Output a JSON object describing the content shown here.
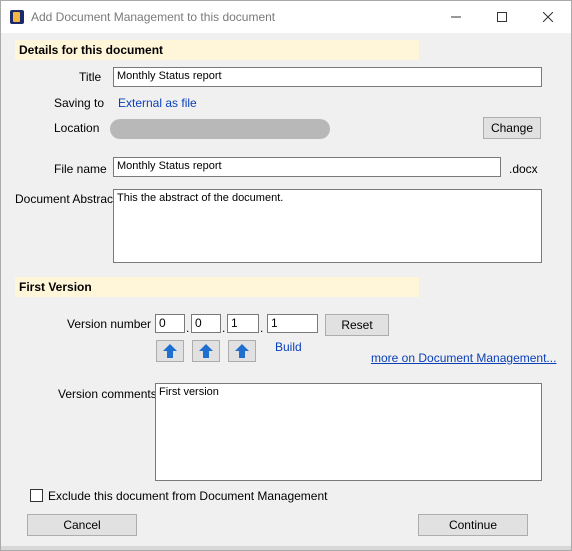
{
  "window": {
    "title": "Add Document Management to this document",
    "minimize_glyph": "—",
    "maximize_glyph": "☐",
    "close_glyph": "✕"
  },
  "details": {
    "header": "Details for this document",
    "title_label": "Title",
    "title_value": "Monthly Status report",
    "saving_to_label": "Saving to",
    "saving_to_value": "External as file",
    "location_label": "Location",
    "change_button": "Change",
    "filename_label": "File name",
    "filename_value": "Monthly Status report",
    "extension": ".docx",
    "abstract_label": "Document Abstract",
    "abstract_value": "This the abstract of the document."
  },
  "version": {
    "header": "First Version",
    "number_label": "Version number",
    "parts": [
      "0",
      "0",
      "1",
      "1"
    ],
    "separator": ".",
    "reset_button": "Reset",
    "build_label": "Build",
    "more_link": "more on Document Management...",
    "comments_label": "Version comments",
    "comments_value": "First version"
  },
  "footer": {
    "exclude_label": "Exclude this document from Document Management",
    "exclude_checked": false,
    "cancel_button": "Cancel",
    "continue_button": "Continue"
  },
  "icons": {
    "app": "document-management-app-icon",
    "arrow": "up-arrow-icon",
    "arrow_color": "#1f6fd0"
  }
}
